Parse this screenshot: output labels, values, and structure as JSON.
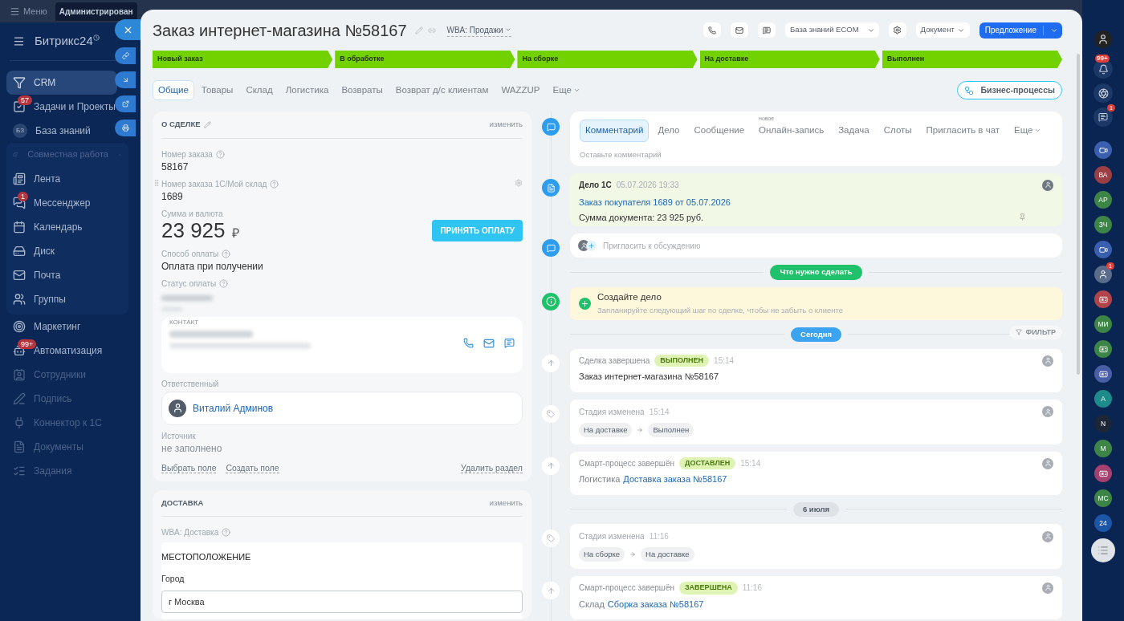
{
  "top_bar": {
    "menu": "Меню",
    "tab": "Администрирован"
  },
  "sidebar": {
    "logo": "Битрикс24",
    "items": [
      {
        "label": "CRM",
        "selected": true
      },
      {
        "label": "Задачи и Проекты",
        "badge": "57",
        "selected": false
      },
      {
        "label": "База знаний",
        "icon_text": "БЗ",
        "selected": false
      },
      {
        "label": "Совместная работа",
        "selected": false,
        "expanded": true,
        "children": [
          {
            "label": "Лента",
            "selected": false
          },
          {
            "label": "Мессенджер",
            "badge": "1",
            "selected": false
          },
          {
            "label": "Календарь",
            "selected": false
          },
          {
            "label": "Диск",
            "selected": false
          },
          {
            "label": "Почта",
            "selected": false
          },
          {
            "label": "Группы",
            "selected": false
          }
        ]
      },
      {
        "label": "Маркетинг",
        "selected": false
      },
      {
        "label": "Автоматизация",
        "badge": "99+",
        "selected": false
      },
      {
        "label": "Сотрудники",
        "selected": false
      },
      {
        "label": "Подпись",
        "selected": false
      },
      {
        "label": "Коннектор к 1С",
        "selected": false
      },
      {
        "label": "Документы",
        "selected": false
      },
      {
        "label": "Задания",
        "selected": false
      }
    ]
  },
  "header": {
    "title": "Заказ интернет-магазина №58167",
    "category": "WBA: Продажи",
    "knowledge_base": "База знаний ECOM",
    "document": "Документ",
    "primary": "Предложение"
  },
  "stages": [
    {
      "label": "Новый заказ",
      "done": true
    },
    {
      "label": "В обработке",
      "done": true
    },
    {
      "label": "На сборке",
      "done": true
    },
    {
      "label": "На доставке",
      "done": true
    },
    {
      "label": "Выполнен",
      "done": true
    }
  ],
  "tabs": [
    {
      "label": "Общие",
      "selected": true
    },
    {
      "label": "Товары",
      "selected": false
    },
    {
      "label": "Склад",
      "selected": false
    },
    {
      "label": "Логистика",
      "selected": false
    },
    {
      "label": "Возвраты",
      "selected": false
    },
    {
      "label": "Возврат д/с клиентам",
      "selected": false
    },
    {
      "label": "WAZZUP",
      "selected": false
    },
    {
      "label": "Еще",
      "selected": false,
      "dropdown": true
    }
  ],
  "business_processes": "Бизнес-процессы",
  "deal": {
    "title": "О СДЕЛКЕ",
    "edit": "изменить",
    "fields": [
      {
        "kind": "text",
        "label": "Номер заказа",
        "help": true,
        "value": "58167"
      },
      {
        "kind": "text",
        "label": "Номер заказа 1С/Мой склад",
        "help": true,
        "value": "1689",
        "draggable": true
      },
      {
        "kind": "amount",
        "label": "Сумма и валюта",
        "value": "23 925",
        "currency": "₽",
        "action": "ПРИНЯТЬ ОПЛАТУ"
      },
      {
        "kind": "text",
        "label": "Способ оплаты",
        "help": true,
        "value": "Оплата при получении"
      },
      {
        "kind": "blurred",
        "label": "Статус оплаты",
        "help": true
      },
      {
        "kind": "contact",
        "label": "КОНТАКТ"
      },
      {
        "kind": "user",
        "label": "Ответственный",
        "value": "Виталий Админов"
      },
      {
        "kind": "empty",
        "label": "Источник",
        "value": "не заполнено"
      }
    ],
    "links": [
      "Выбрать поле",
      "Создать поле"
    ],
    "remove": "Удалить раздел"
  },
  "delivery": {
    "title": "ДОСТАВКА",
    "edit": "изменить",
    "field": "WBA: Доставка",
    "section": "МЕСТОПОЛОЖЕНИЕ",
    "city_label": "Город",
    "city": "г Москва"
  },
  "timeline": {
    "composer": {
      "tabs": [
        {
          "label": "Комментарий",
          "selected": true
        },
        {
          "label": "Дело",
          "selected": false
        },
        {
          "label": "Сообщение",
          "selected": false
        },
        {
          "label": "Онлайн-запись",
          "selected": false,
          "note": "новое"
        },
        {
          "label": "Задача",
          "selected": false
        },
        {
          "label": "Слоты",
          "selected": false
        },
        {
          "label": "Пригласить в чат",
          "selected": false
        },
        {
          "label": "Еще",
          "selected": false,
          "dropdown": true
        }
      ],
      "placeholder": "Оставьте комментарий"
    },
    "document": {
      "title": "Дело 1С",
      "time": "05.07.2026 19:33",
      "link": "Заказ покупателя 1689 от 05.07.2026",
      "text": "Сумма документа: 23 925 руб."
    },
    "invite": {
      "placeholder": "Пригласить к обсуждению"
    },
    "todo_label": "Что нужно сделать",
    "todo": {
      "title": "Создайте дело",
      "hint": "Запланируйте следующий шаг по сделке, чтобы не забыть о клиенте"
    },
    "filter": "ФИЛЬТР",
    "groups": [
      {
        "date": "Сегодня",
        "current": true,
        "entries": [
          {
            "kind": "done",
            "title": "Сделка завершена",
            "badge": "ВЫПОЛНЕН",
            "time": "15:14",
            "text": "Заказ интернет-магазина №58167"
          },
          {
            "kind": "stage",
            "title": "Стадия изменена",
            "time": "15:14",
            "from": "На доставке",
            "to": "Выполнен"
          },
          {
            "kind": "done",
            "title": "Смарт-процесс завершён",
            "badge": "ДОСТАВЛЕН",
            "time": "15:14",
            "prefix": "Логистика",
            "link": "Доставка заказа №58167"
          }
        ]
      },
      {
        "date": "6 июля",
        "current": false,
        "entries": [
          {
            "kind": "stage",
            "title": "Стадия изменена",
            "time": "11:16",
            "from": "На сборке",
            "to": "На доставке"
          },
          {
            "kind": "done",
            "title": "Смарт-процесс завершён",
            "badge": "ЗАВЕРШЕНА",
            "time": "11:16",
            "prefix": "Склад",
            "link": "Сборка заказа №58167"
          }
        ]
      }
    ]
  },
  "rail": {
    "notifications": "99+",
    "chat_badge": "1",
    "items": [
      {
        "kind": "video",
        "color": "#3a5fae"
      },
      {
        "kind": "initials",
        "text": "ВА",
        "color": "#9c3f45"
      },
      {
        "kind": "initials",
        "text": "АР",
        "color": "#3d8447"
      },
      {
        "kind": "initials",
        "text": "ЗЧ",
        "color": "#3d8447"
      },
      {
        "kind": "video",
        "color": "#3a5fae"
      },
      {
        "kind": "photo",
        "badge": "1",
        "color": "#5b6b8a"
      },
      {
        "kind": "card",
        "color": "#b0444a"
      },
      {
        "kind": "initials",
        "text": "МИ",
        "color": "#3d8447"
      },
      {
        "kind": "card",
        "color": "#3d8447"
      },
      {
        "kind": "card",
        "color": "#4a5ea6"
      },
      {
        "kind": "initials",
        "text": "А",
        "color": "#1f8a8a"
      },
      {
        "kind": "initials",
        "text": "N",
        "color": "#1c2636"
      },
      {
        "kind": "initials",
        "text": "М",
        "color": "#3d8447"
      },
      {
        "kind": "card",
        "color": "#a5416e"
      },
      {
        "kind": "initials",
        "text": "МС",
        "color": "#3d8447"
      },
      {
        "kind": "initials",
        "text": "24",
        "color": "#1d56a6"
      }
    ]
  }
}
